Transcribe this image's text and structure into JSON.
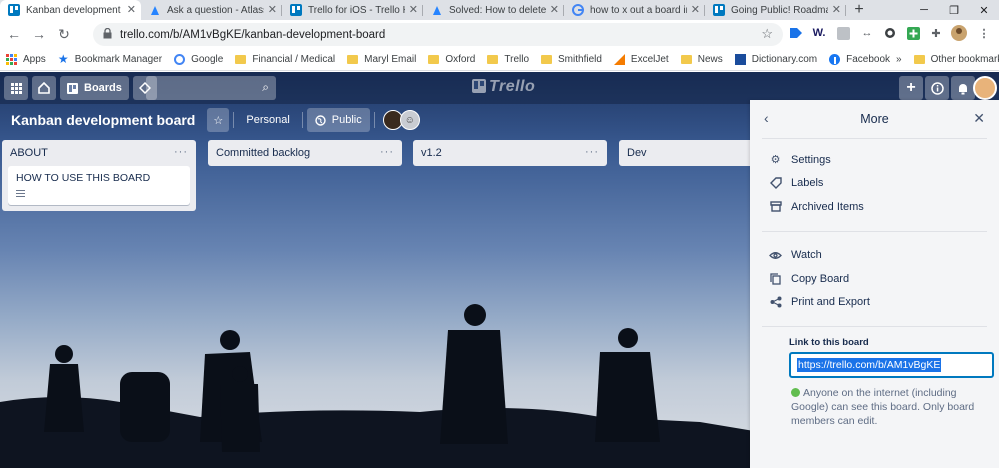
{
  "browser": {
    "tabs": [
      {
        "title": "Kanban development b",
        "icon": "trello-icon",
        "active": true
      },
      {
        "title": "Ask a question - Atlassi",
        "icon": "atlassian-icon",
        "active": false
      },
      {
        "title": "Trello for iOS - Trello He",
        "icon": "trello-icon",
        "active": false
      },
      {
        "title": "Solved: How to delete a",
        "icon": "atlassian-icon",
        "active": false
      },
      {
        "title": "how to x out a board in",
        "icon": "google-icon",
        "active": false
      },
      {
        "title": "Going Public! Roadmap",
        "icon": "trello-icon",
        "active": false
      }
    ],
    "new_tab": "+",
    "url": "trello.com/b/AM1vBgKE/kanban-development-board",
    "bookmarks": [
      {
        "label": "Apps",
        "icon": "apps-grid-icon"
      },
      {
        "label": "Bookmark Manager",
        "icon": "star-icon"
      },
      {
        "label": "Google",
        "icon": "google-icon"
      },
      {
        "label": "Financial / Medical",
        "icon": "folder-icon"
      },
      {
        "label": "Maryl Email",
        "icon": "folder-icon"
      },
      {
        "label": "Oxford",
        "icon": "folder-icon"
      },
      {
        "label": "Trello",
        "icon": "folder-icon"
      },
      {
        "label": "Smithfield",
        "icon": "folder-icon"
      },
      {
        "label": "ExcelJet",
        "icon": "exceljet-icon"
      },
      {
        "label": "News",
        "icon": "folder-icon"
      },
      {
        "label": "Dictionary.com",
        "icon": "dictionary-icon"
      },
      {
        "label": "Facebook",
        "icon": "facebook-icon"
      }
    ],
    "overflow": "»",
    "other_bookmarks": "Other bookmarks"
  },
  "trello": {
    "boards_label": "Boards",
    "logo_text": "Trello",
    "board_title": "Kanban development board",
    "team_label": "Personal",
    "visibility_label": "Public",
    "lists": [
      {
        "title": "ABOUT",
        "cards": [
          "HOW TO USE THIS BOARD"
        ]
      },
      {
        "title": "Committed backlog",
        "cards": []
      },
      {
        "title": "v1.2",
        "cards": []
      },
      {
        "title": "Dev",
        "cards": []
      }
    ],
    "list_menu": "···"
  },
  "menu": {
    "title": "More",
    "items_group1": [
      {
        "label": "Settings",
        "icon": "gear-icon"
      },
      {
        "label": "Labels",
        "icon": "label-icon"
      },
      {
        "label": "Archived Items",
        "icon": "archive-icon"
      }
    ],
    "items_group2": [
      {
        "label": "Watch",
        "icon": "eye-icon"
      },
      {
        "label": "Copy Board",
        "icon": "copy-icon"
      },
      {
        "label": "Print and Export",
        "icon": "share-icon"
      }
    ],
    "link_label": "Link to this board",
    "link_value": "https://trello.com/b/AM1vBgKE",
    "link_info": "Anyone on the internet (including Google) can see this board. Only board members can edit."
  },
  "colors": {
    "trello_blue": "#0079bf",
    "menu_bg": "#f4f5f7",
    "list_bg": "#ebecf0"
  }
}
